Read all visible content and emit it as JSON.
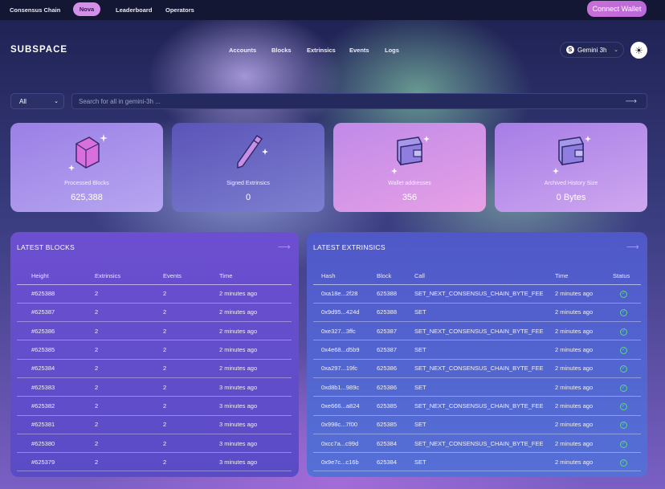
{
  "topbar": {
    "tabs": [
      "Consensus Chain",
      "Nova",
      "Leaderboard",
      "Operators"
    ],
    "active_tab": "Nova",
    "connect_label": "Connect Wallet"
  },
  "header": {
    "logo": "SUBSPACE",
    "nav": [
      "Accounts",
      "Blocks",
      "Extrinsics",
      "Events",
      "Logs"
    ],
    "network_icon": "S",
    "network": "Gemini 3h"
  },
  "search": {
    "filter": "All",
    "placeholder": "Search for all in gemini-3h ..."
  },
  "stats": [
    {
      "label": "Processed Blocks",
      "value": "625,388",
      "icon": "cube-icon"
    },
    {
      "label": "Signed Extrinsics",
      "value": "0",
      "icon": "pen-icon"
    },
    {
      "label": "Wallet addresses",
      "value": "356",
      "icon": "wallet-icon"
    },
    {
      "label": "Archived History Size",
      "value": "0 Bytes",
      "icon": "wallet-icon"
    }
  ],
  "latest_blocks": {
    "title": "LATEST BLOCKS",
    "columns": [
      "Height",
      "Extrinsics",
      "Events",
      "Time"
    ],
    "rows": [
      [
        "#625388",
        "2",
        "2",
        "2 minutes ago"
      ],
      [
        "#625387",
        "2",
        "2",
        "2 minutes ago"
      ],
      [
        "#625386",
        "2",
        "2",
        "2 minutes ago"
      ],
      [
        "#625385",
        "2",
        "2",
        "2 minutes ago"
      ],
      [
        "#625384",
        "2",
        "2",
        "2 minutes ago"
      ],
      [
        "#625383",
        "2",
        "2",
        "3 minutes ago"
      ],
      [
        "#625382",
        "2",
        "2",
        "3 minutes ago"
      ],
      [
        "#625381",
        "2",
        "2",
        "3 minutes ago"
      ],
      [
        "#625380",
        "2",
        "2",
        "3 minutes ago"
      ],
      [
        "#625379",
        "2",
        "2",
        "3 minutes ago"
      ]
    ]
  },
  "latest_extrinsics": {
    "title": "LATEST EXTRINSICS",
    "columns": [
      "Hash",
      "Block",
      "Call",
      "Time",
      "Status"
    ],
    "rows": [
      [
        "0xa18e...2f28",
        "625388",
        "SET_NEXT_CONSENSUS_CHAIN_BYTE_FEE",
        "2 minutes ago"
      ],
      [
        "0x9d95...424d",
        "625388",
        "SET",
        "2 minutes ago"
      ],
      [
        "0xe327...3ffc",
        "625387",
        "SET_NEXT_CONSENSUS_CHAIN_BYTE_FEE",
        "2 minutes ago"
      ],
      [
        "0x4e68...d5b9",
        "625387",
        "SET",
        "2 minutes ago"
      ],
      [
        "0xa297...19fc",
        "625386",
        "SET_NEXT_CONSENSUS_CHAIN_BYTE_FEE",
        "2 minutes ago"
      ],
      [
        "0xd8b1...989c",
        "625386",
        "SET",
        "2 minutes ago"
      ],
      [
        "0xe666...a824",
        "625385",
        "SET_NEXT_CONSENSUS_CHAIN_BYTE_FEE",
        "2 minutes ago"
      ],
      [
        "0x998c...7f00",
        "625385",
        "SET",
        "2 minutes ago"
      ],
      [
        "0xcc7a...c99d",
        "625384",
        "SET_NEXT_CONSENSUS_CHAIN_BYTE_FEE",
        "2 minutes ago"
      ],
      [
        "0x9e7c...c16b",
        "625384",
        "SET",
        "2 minutes ago"
      ]
    ]
  }
}
